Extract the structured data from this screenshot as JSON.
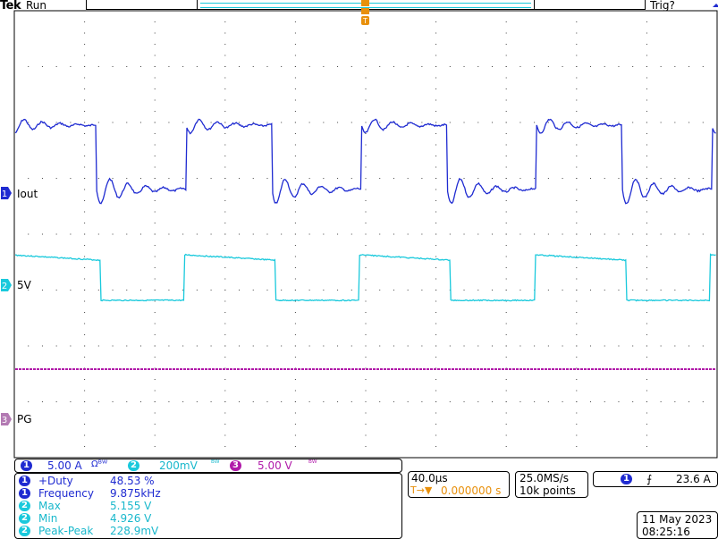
{
  "header": {
    "brand": "Tek",
    "run_state": "Run",
    "trigger_state": "Trig?",
    "trigger_marker": "T"
  },
  "channels": [
    {
      "id": "1",
      "label": "Iout",
      "color": "#1f2bd1"
    },
    {
      "id": "2",
      "label": "5V",
      "color": "#19c9dc"
    },
    {
      "id": "3",
      "label": "PG",
      "color": "#b01aa9"
    }
  ],
  "scale_bar": {
    "ch1": {
      "badge": "1",
      "value": "5.00 A",
      "suffix": "Ωᴮᵂ"
    },
    "ch2": {
      "badge": "2",
      "value": "200mV",
      "suffix": "ᴮᵂ"
    },
    "ch3": {
      "badge": "3",
      "value": "5.00 V",
      "suffix": "ᴮᵂ"
    }
  },
  "measurements": [
    {
      "ch": "1",
      "name": "+Duty",
      "value": "48.53 %"
    },
    {
      "ch": "1",
      "name": "Frequency",
      "value": "9.875kHz"
    },
    {
      "ch": "2",
      "name": "Max",
      "value": "5.155 V"
    },
    {
      "ch": "2",
      "name": "Min",
      "value": "4.926 V"
    },
    {
      "ch": "2",
      "name": "Peak-Peak",
      "value": "228.9mV"
    }
  ],
  "timebase": {
    "scale": "40.0µs",
    "trigger_pos_icon": "T→▼",
    "trigger_pos": "0.000000 s"
  },
  "acquisition": {
    "rate": "25.0MS/s",
    "points": "10k points"
  },
  "trigger": {
    "ch": "1",
    "slope": "rising-edge-icon",
    "slope_glyph": "⨍",
    "level": "23.6 A"
  },
  "datetime": {
    "date": "11 May 2023",
    "time": "08:25:16"
  },
  "colors": {
    "ch1": "#1f2bd1",
    "ch2": "#19c9dc",
    "ch3": "#b01aa9",
    "trigger": "#e8900c"
  }
}
